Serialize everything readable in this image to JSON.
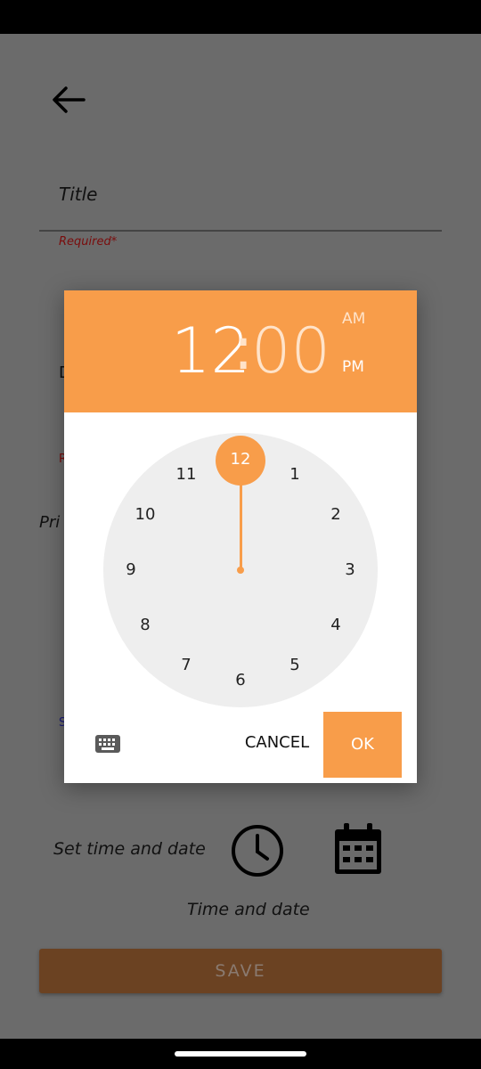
{
  "form": {
    "title_label": "Title",
    "required_label": "Required*",
    "partial_d": "D",
    "partial_r": "R",
    "partial_price": "Pri",
    "partial_s": "S",
    "set_time_label": "Set time and date",
    "time_date_label": "Time and date",
    "save_label": "SAVE"
  },
  "dialog": {
    "hour": "12",
    "colon": ":",
    "minute": "00",
    "am_label": "AM",
    "pm_label": "PM",
    "clock_numbers": [
      "12",
      "1",
      "2",
      "3",
      "4",
      "5",
      "6",
      "7",
      "8",
      "9",
      "10",
      "11"
    ],
    "selected_hour": "12",
    "cancel_label": "CANCEL",
    "ok_label": "OK"
  },
  "colors": {
    "accent": "#f89d4a",
    "scrim": "#6b6b6b",
    "save_dimmed": "#6b4222",
    "clock_face": "#eeeeee"
  },
  "icons": {
    "back": "arrow-left-icon",
    "clock": "clock-icon",
    "calendar": "calendar-icon",
    "keyboard": "keyboard-icon"
  }
}
